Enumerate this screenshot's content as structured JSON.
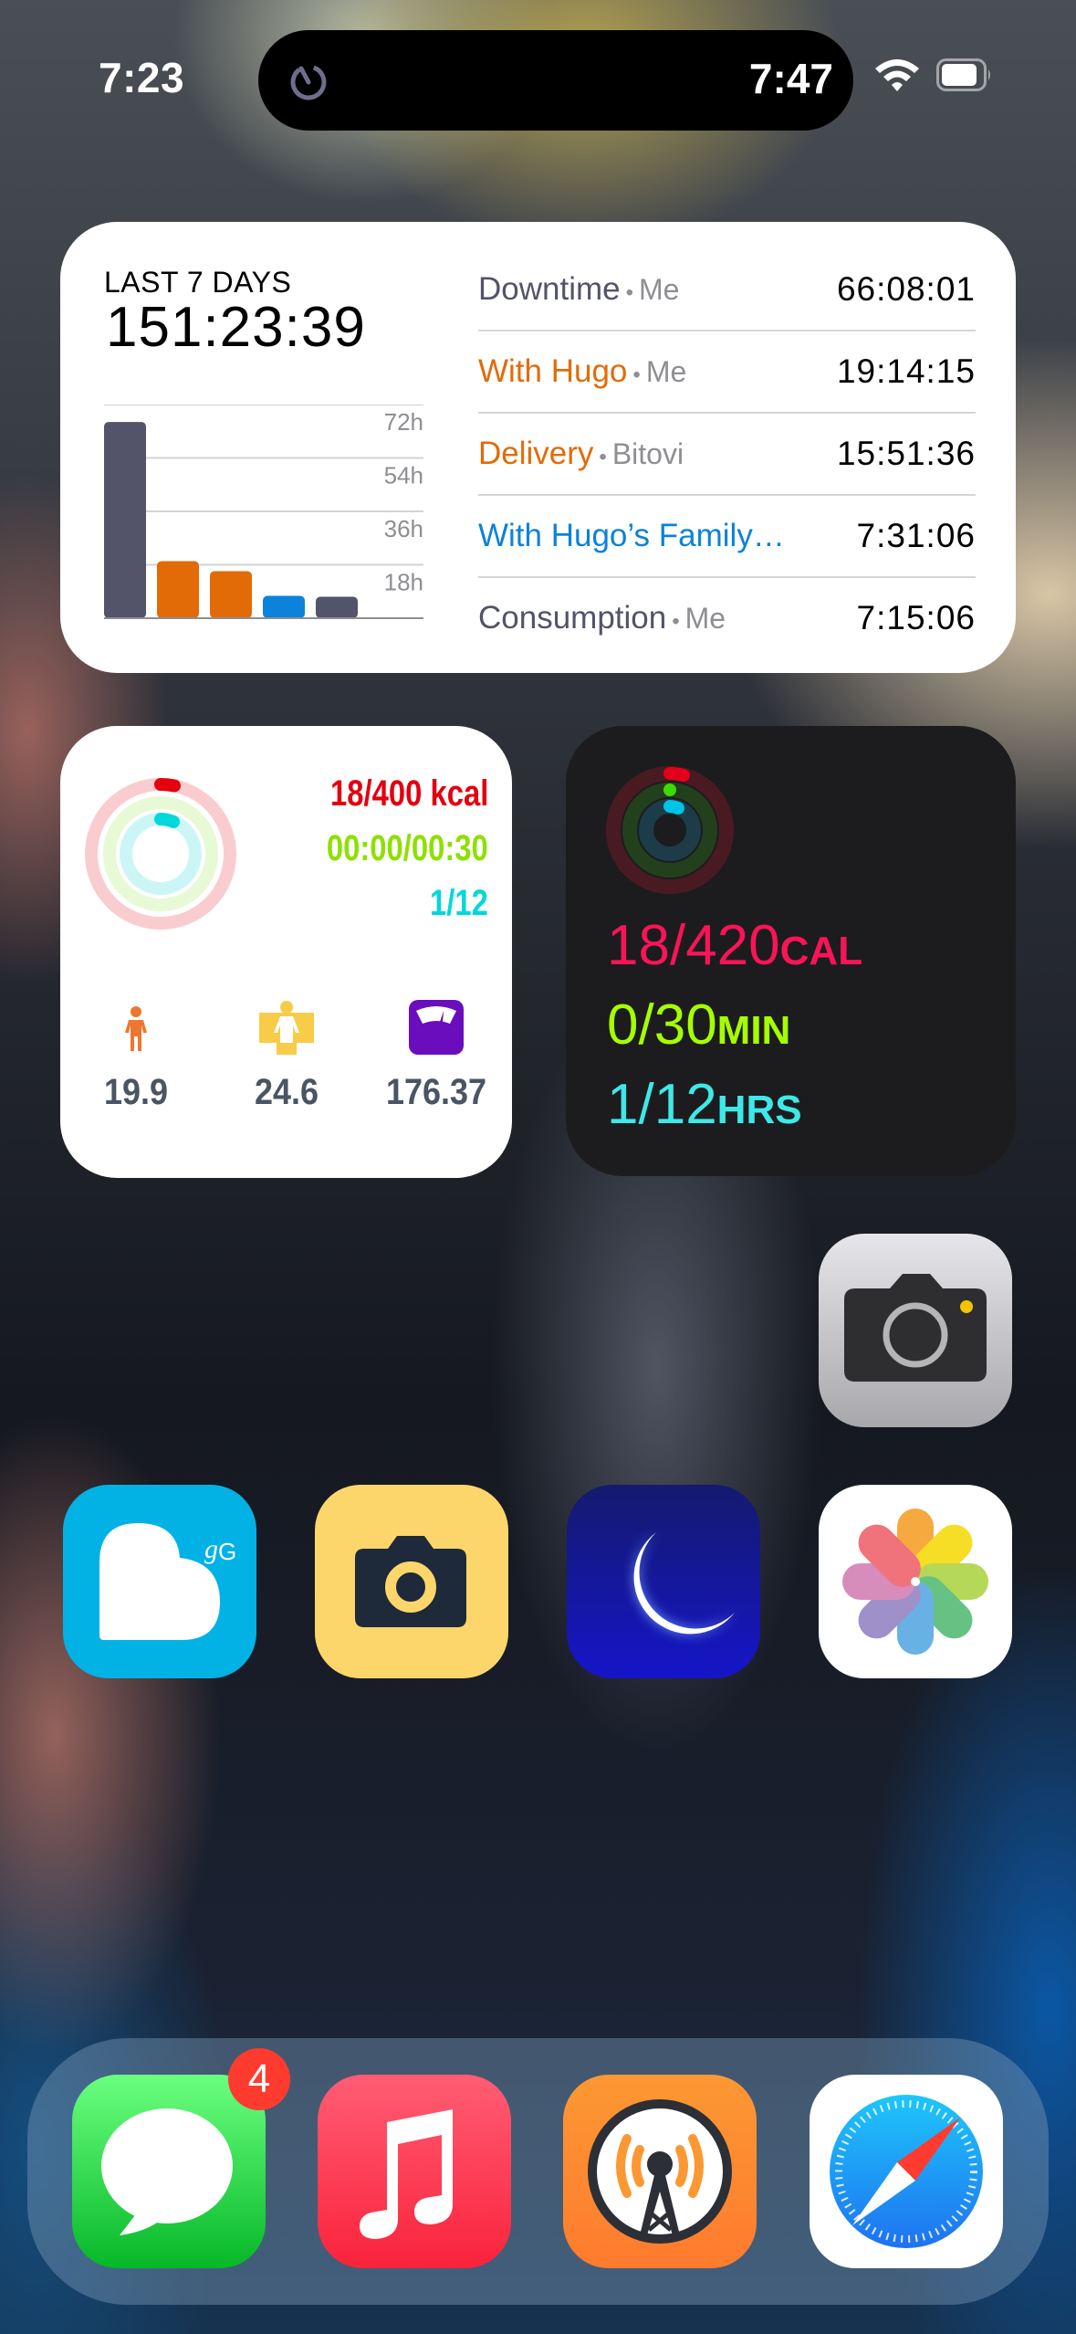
{
  "status_bar": {
    "time": "7:23",
    "live_activity_time": "7:47",
    "icons": [
      "timer-icon",
      "wifi-icon",
      "battery-icon"
    ]
  },
  "timing_widget": {
    "label": "LAST 7 DAYS",
    "total": "151:23:39",
    "rows": [
      {
        "category": "Downtime",
        "owner": "Me",
        "duration": "66:08:01",
        "color": "#53536a"
      },
      {
        "category": "With Hugo",
        "owner": "Me",
        "duration": "19:14:15",
        "color": "#e36b07"
      },
      {
        "category": "Delivery",
        "owner": "Bitovi",
        "duration": "15:51:36",
        "color": "#e36b07"
      },
      {
        "category": "With Hugo’s Family…",
        "owner": "",
        "duration": "7:31:06",
        "color": "#0c82db"
      },
      {
        "category": "Consumption",
        "owner": "Me",
        "duration": "7:15:06",
        "color": "#53536a"
      }
    ],
    "separator": "•"
  },
  "chart_data": {
    "type": "bar",
    "title": "LAST 7 DAYS",
    "categories": [
      "Downtime",
      "With Hugo",
      "Delivery",
      "With Hugo's Family",
      "Consumption"
    ],
    "values": [
      66.13,
      19.24,
      15.86,
      7.52,
      7.25
    ],
    "colors": [
      "#53536a",
      "#e36b07",
      "#e36b07",
      "#0c82db",
      "#53536a"
    ],
    "yticks": [
      18,
      36,
      54,
      72
    ],
    "ytick_labels": [
      "18h",
      "36h",
      "54h",
      "72h"
    ],
    "ylim": [
      0,
      72
    ],
    "xlabel": "",
    "ylabel": "",
    "grid": true,
    "axis_side": "right"
  },
  "fitness_widget": {
    "move": {
      "text": "18/400 kcal",
      "value": 18,
      "goal": 400,
      "color": "#e3000f"
    },
    "exercise": {
      "text": "00:00/00:30",
      "value": 0,
      "goal": 30,
      "color": "#8ee000"
    },
    "stand": {
      "text": "1/12",
      "value": 1,
      "goal": 12,
      "color": "#00d8dc"
    },
    "metrics": [
      {
        "icon": "person-icon",
        "value": "19.9",
        "color": "#ee7730"
      },
      {
        "icon": "body-shape-icon",
        "value": "24.6",
        "color": "#f8cc48"
      },
      {
        "icon": "scale-icon",
        "value": "176.37",
        "color": "#6a0dbd"
      }
    ]
  },
  "activity_widget": {
    "move": {
      "value": "18/420",
      "unit": "CAL",
      "progress": 0.043,
      "color": "#fa1457"
    },
    "exercise": {
      "value": "0/30",
      "unit": "MIN",
      "progress": 0.0,
      "color": "#a6ff00"
    },
    "stand": {
      "value": "1/12",
      "unit": "HRS",
      "progress": 0.083,
      "color": "#3ee8e8"
    }
  },
  "apps": [
    {
      "name": "Camera",
      "icon": "camera-icon"
    },
    {
      "name": "Glucose Buddy",
      "icon": "heart-g-icon"
    },
    {
      "name": "Halide Camera",
      "icon": "camera-yellow-icon"
    },
    {
      "name": "Sleep",
      "icon": "moon-icon"
    },
    {
      "name": "Photos",
      "icon": "photos-flower-icon"
    }
  ],
  "dock": [
    {
      "name": "Messages",
      "icon": "messages-icon",
      "badge": "4"
    },
    {
      "name": "Music",
      "icon": "music-note-icon"
    },
    {
      "name": "Overcast",
      "icon": "podcast-tower-icon"
    },
    {
      "name": "Safari",
      "icon": "compass-icon"
    }
  ]
}
